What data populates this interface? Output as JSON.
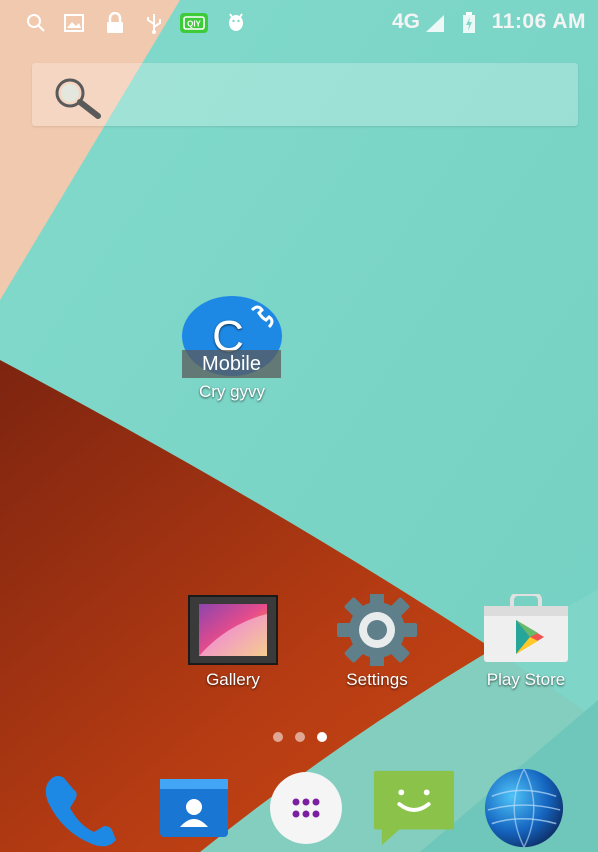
{
  "status_bar": {
    "network": "4G",
    "time": "11:06 AM"
  },
  "search": {
    "icon": "search-icon"
  },
  "desktop_shortcut": {
    "badge": "Mobile",
    "label": "Cry gyvy"
  },
  "apps": [
    {
      "label": "Gallery",
      "icon": "gallery-icon"
    },
    {
      "label": "Settings",
      "icon": "settings-icon"
    },
    {
      "label": "Play Store",
      "icon": "play-store-icon"
    }
  ],
  "page_indicator": {
    "pages": 3,
    "active": 3
  },
  "dock": [
    {
      "icon": "phone-icon"
    },
    {
      "icon": "contacts-icon"
    },
    {
      "icon": "app-drawer-icon"
    },
    {
      "icon": "messaging-icon"
    },
    {
      "icon": "browser-globe-icon"
    }
  ],
  "colors": {
    "wallpaper_teal": "#7fd8c8",
    "wallpaper_peach": "#f0c7ad",
    "wallpaper_red": "#b43a14",
    "status_green": "#3ecb3a"
  }
}
